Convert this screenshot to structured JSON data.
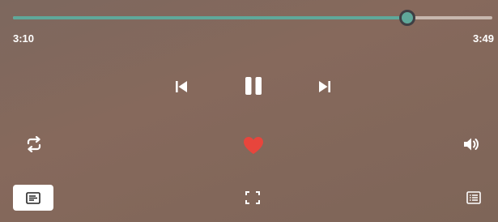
{
  "player": {
    "elapsed_time": "3:10",
    "total_time": "3:49",
    "progress_fraction": 0.822
  },
  "controls": {
    "icons": {
      "previous": "skip-previous-icon",
      "pause": "pause-icon",
      "next": "skip-next-icon",
      "repeat": "repeat-icon",
      "like": "heart-icon",
      "volume": "volume-icon",
      "lyrics": "lyrics-icon",
      "fullscreen": "fullscreen-icon",
      "queue": "queue-list-icon"
    },
    "liked": true
  },
  "colors": {
    "accent": "#5fa89a",
    "heart": "#e8453c",
    "track": "#c7b7ae",
    "background": "#806759"
  }
}
